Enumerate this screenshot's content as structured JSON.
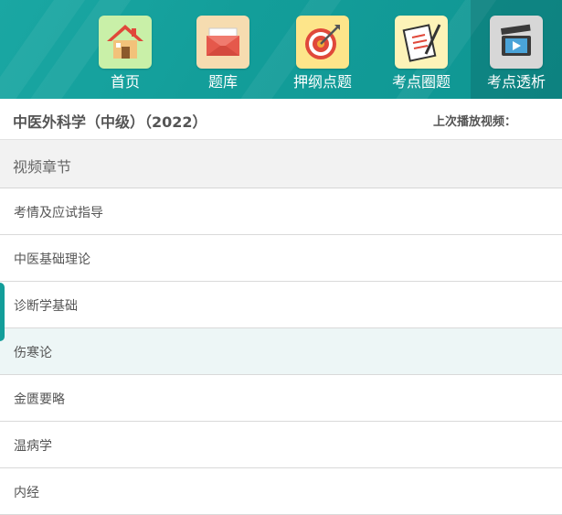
{
  "nav": {
    "items": [
      {
        "label": "首页",
        "icon": "home-icon",
        "active": false
      },
      {
        "label": "题库",
        "icon": "mail-icon",
        "active": false
      },
      {
        "label": "押纲点题",
        "icon": "target-icon",
        "active": false
      },
      {
        "label": "考点圈题",
        "icon": "clipboard-icon",
        "active": false
      },
      {
        "label": "考点透析",
        "icon": "video-clapper-icon",
        "active": true
      }
    ],
    "colors": {
      "bar": "#139e9a",
      "home_tile": "#c9f0a8",
      "mail_tile": "#f6dcb0",
      "target_tile": "#fde58a",
      "clipboard_tile": "#fdf3b8",
      "video_tile": "#d7d7d7"
    }
  },
  "course": {
    "title": "中医外科学（中级）（2022）",
    "last_played_label": "上次播放视频："
  },
  "chapters": {
    "header": "视频章节",
    "items": [
      "考情及应试指导",
      "中医基础理论",
      "诊断学基础",
      "伤寒论",
      "金匮要略",
      "温病学",
      "内经"
    ],
    "highlighted_index": 3
  }
}
